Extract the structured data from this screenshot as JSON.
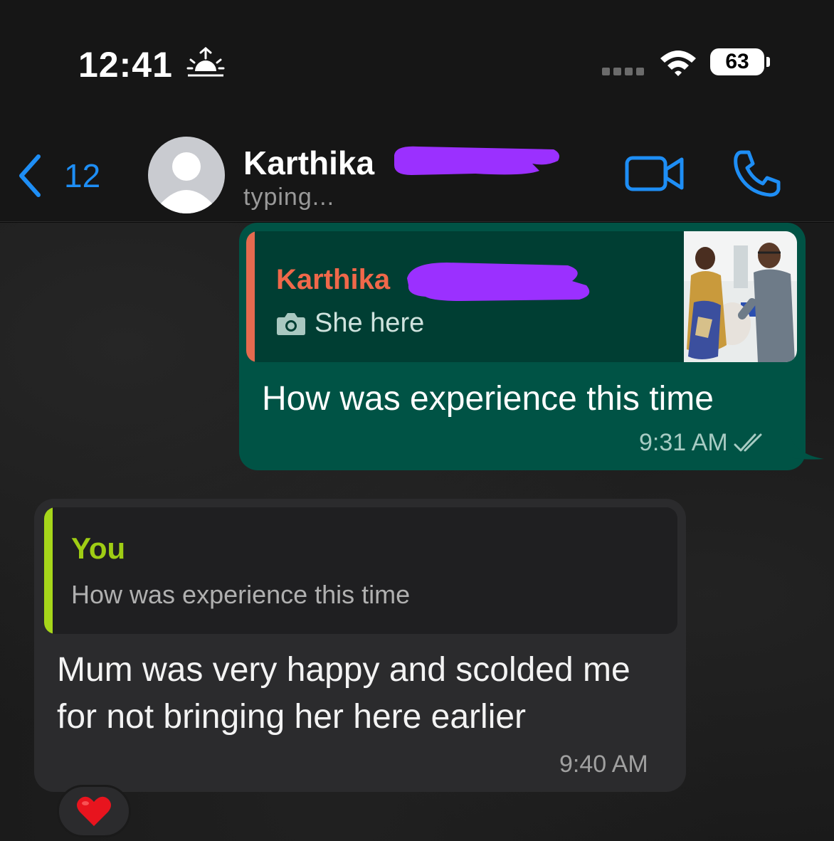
{
  "status_bar": {
    "time": "12:41",
    "battery_level": "63",
    "icons": [
      "sunrise-alarm-icon",
      "signal-dots-icon",
      "wifi-icon",
      "battery-icon"
    ]
  },
  "header": {
    "back_count": "12",
    "contact_name": "Karthika",
    "status": "typing...",
    "icons": [
      "chevron-left-icon",
      "avatar-placeholder-icon",
      "video-call-icon",
      "phone-icon"
    ],
    "accent_color": "#1e8ef5"
  },
  "messages": [
    {
      "direction": "outgoing",
      "quoted": {
        "author": "Karthika",
        "text": "She here",
        "media": "photo",
        "bar_color": "#e56a4f"
      },
      "text": "How was experience this time",
      "time": "9:31 AM",
      "read_receipt": "double-check-icon",
      "bubble_color": "#005345"
    },
    {
      "direction": "incoming",
      "quoted": {
        "author": "You",
        "text": "How was experience this time",
        "bar_color": "#a6d61a"
      },
      "text": "Mum was very happy and scolded me for not bringing her here earlier",
      "time": "9:40 AM",
      "reaction": "❤️",
      "bubble_color": "#2b2b2d"
    }
  ],
  "redaction_color": "#9b30ff"
}
